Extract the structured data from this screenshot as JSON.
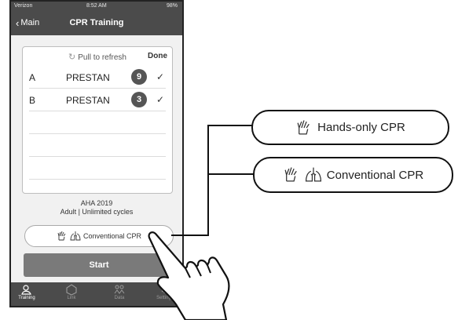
{
  "status_bar": {
    "carrier": "Verizon",
    "time": "8:52 AM",
    "battery": "98%"
  },
  "nav": {
    "back_label": "Main",
    "title": "CPR Training"
  },
  "list": {
    "refresh_label": "Pull to refresh",
    "done_label": "Done",
    "rows": [
      {
        "letter": "A",
        "name": "PRESTAN",
        "count": "9"
      },
      {
        "letter": "B",
        "name": "PRESTAN",
        "count": "3"
      }
    ]
  },
  "info": {
    "guideline": "AHA 2019",
    "mode": "Adult | Unlimited cycles"
  },
  "mode_button": {
    "label": "Conventional CPR"
  },
  "start_button": {
    "label": "Start"
  },
  "tabs": [
    {
      "label": "Training",
      "icon": "training-icon"
    },
    {
      "label": "Link",
      "icon": "link-icon"
    },
    {
      "label": "Data",
      "icon": "data-icon"
    },
    {
      "label": "Settings",
      "icon": "settings-icon"
    }
  ],
  "callouts": {
    "hands_only": "Hands-only CPR",
    "conventional": "Conventional CPR"
  },
  "colors": {
    "bar": "#4b4b4b",
    "badge": "#555555",
    "start": "#7a7a7a"
  }
}
